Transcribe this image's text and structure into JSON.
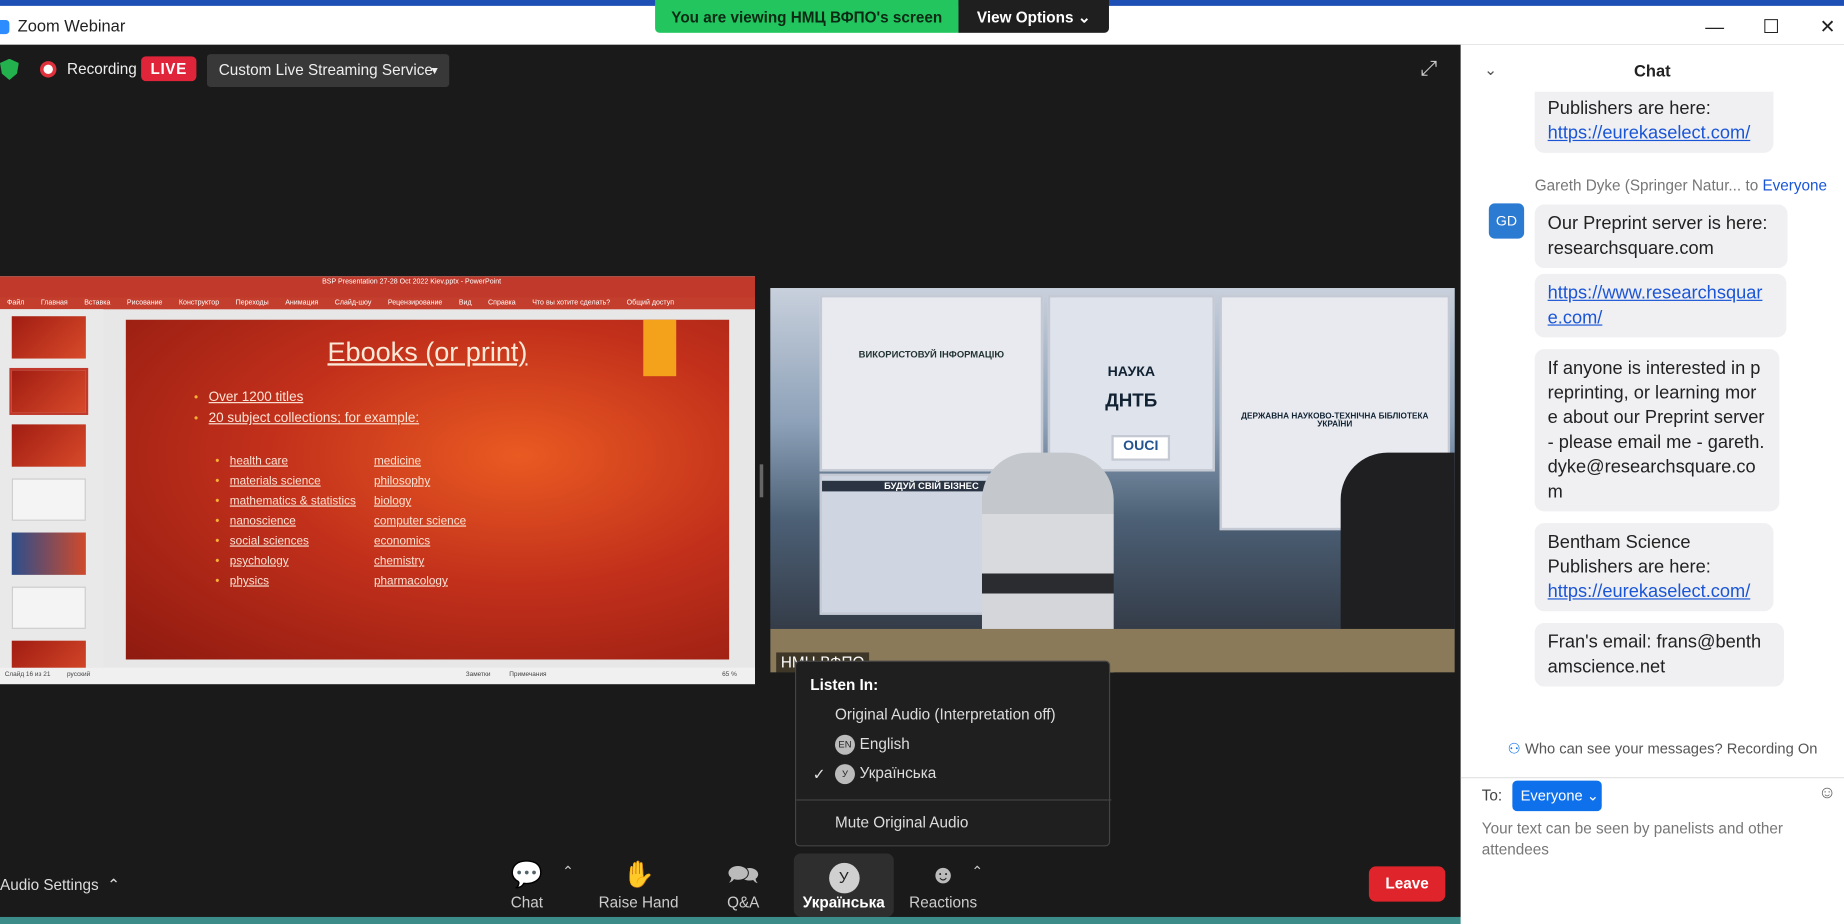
{
  "window": {
    "app_title": "Zoom Webinar",
    "banner_text": "You are viewing НМЦ ВФПО's screen",
    "view_options": "View Options ⌄",
    "minimize": "—",
    "maximize": "☐",
    "close": "✕"
  },
  "status": {
    "recording": "Recording",
    "live": "LIVE",
    "stream_service": "Custom Live Streaming Service"
  },
  "powerpoint": {
    "title": "BSP Presentation 27-28 Oct 2022 Kiev.pptx - PowerPoint",
    "menu": [
      "Файл",
      "Главная",
      "Вставка",
      "Рисование",
      "Конструктор",
      "Переходы",
      "Анимация",
      "Слайд-шоу",
      "Рецензирование",
      "Вид",
      "Справка",
      "Что вы хотите сделать?",
      "Общий доступ"
    ],
    "status_left": "Слайд 16 из 21",
    "status_lang": "русский",
    "status_notes": "Заметки",
    "status_comments": "Примечания",
    "zoom": "65 %"
  },
  "slide": {
    "title": "Ebooks (or print)",
    "bullets": [
      "Over 1200 titles",
      "20 subject collections; for example:"
    ],
    "left_col": [
      "health care",
      "materials science",
      "mathematics & statistics",
      "nanoscience",
      "social sciences",
      "psychology",
      "physics"
    ],
    "right_col": [
      "medicine",
      "philosophy",
      "biology",
      "computer science",
      "economics",
      "chemistry",
      "pharmacology"
    ]
  },
  "video": {
    "label": "НМЦ ВФПО",
    "posters": [
      "ВИКОРИСТОВУЙ ІНФОРМАЦІЮ",
      "НАУКА",
      "ДНТБ",
      "БУДУЙ СВІЙ БІЗНЕС",
      "OUCI",
      "ДЕРЖАВНА НАУКОВО-ТЕХНІЧНА БІБЛІОТЕКА УКРАЇНИ"
    ]
  },
  "listen_in": {
    "header": "Listen In:",
    "options": [
      "Original Audio (Interpretation off)",
      "English",
      "Українська"
    ],
    "en_badge": "EN",
    "uk_badge": "У",
    "checkmark": "✓",
    "mute": "Mute Original Audio"
  },
  "toolbar": {
    "audio_settings": "Audio Settings",
    "chat": "Chat",
    "raise_hand": "Raise Hand",
    "qa": "Q&A",
    "language": "Українська",
    "language_badge": "У",
    "reactions": "Reactions",
    "leave": "Leave"
  },
  "chat": {
    "title": "Chat",
    "msg_top_line": "Publishers are here:",
    "msg_top_link": "https://eurekaselect.com/",
    "sender_name": "Gareth Dyke (Springer Natur...",
    "sender_to": "to",
    "sender_target": "Everyone",
    "avatar": "GD",
    "msg1": "Our Preprint server is here: researchsquare.com",
    "msg2": "https://www.researchsquare.com/",
    "msg3": "If anyone is interested in preprinting, or learning more about our Preprint server - please email me - gareth.dyke@researchsquare.com",
    "msg4_line1": "Bentham Science Publishers are here:",
    "msg4_link": "https://eurekaselect.com/",
    "msg5": "Fran's email: frans@benthamscience.net",
    "who_can_see": "Who can see your messages? Recording On",
    "to_label": "To:",
    "to_target": "Everyone",
    "input_placeholder": "Your text can be seen by panelists and other attendees"
  }
}
